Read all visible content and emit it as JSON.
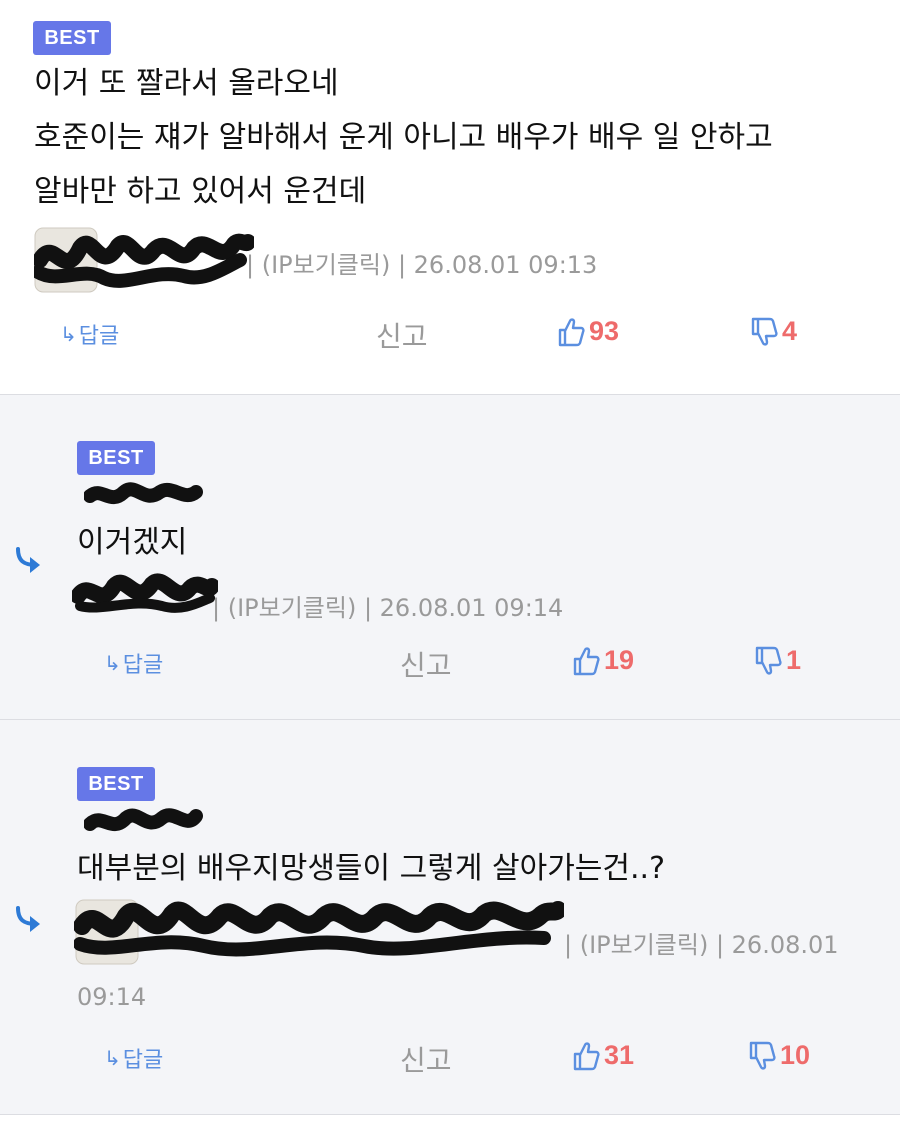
{
  "badge": "BEST",
  "comments": [
    {
      "lines": [
        "이거 또 짤라서 올라오네",
        "호준이는 쟤가 알바해서 운게 아니고 배우가 배우 일 안하고",
        "알바만 하고 있어서 운건데"
      ],
      "meta": "| (IP보기클릭) | 26.08.01 09:13",
      "reply_label": "답글",
      "report_label": "신고",
      "likes": "93",
      "dislikes": "4"
    },
    {
      "lines": [
        "이거겠지"
      ],
      "meta": "| (IP보기클릭) | 26.08.01 09:14",
      "reply_label": "답글",
      "report_label": "신고",
      "likes": "19",
      "dislikes": "1"
    },
    {
      "lines": [
        "대부분의 배우지망생들이 그렇게 살아가는건..?"
      ],
      "meta": "| (IP보기클릭) | 26.08.01",
      "meta_wrap": "09:14",
      "reply_label": "답글",
      "report_label": "신고",
      "likes": "31",
      "dislikes": "10"
    }
  ],
  "icons": {
    "reply": "reply-arrow-icon",
    "like": "thumbs-up-icon",
    "dislike": "thumbs-down-icon",
    "nested": "nested-reply-arrow-icon"
  },
  "colors": {
    "badge": "#6677e8",
    "vote": "#ee6b6b",
    "icon_blue": "#5b8fe0",
    "nested_bg": "#f4f5f8"
  }
}
